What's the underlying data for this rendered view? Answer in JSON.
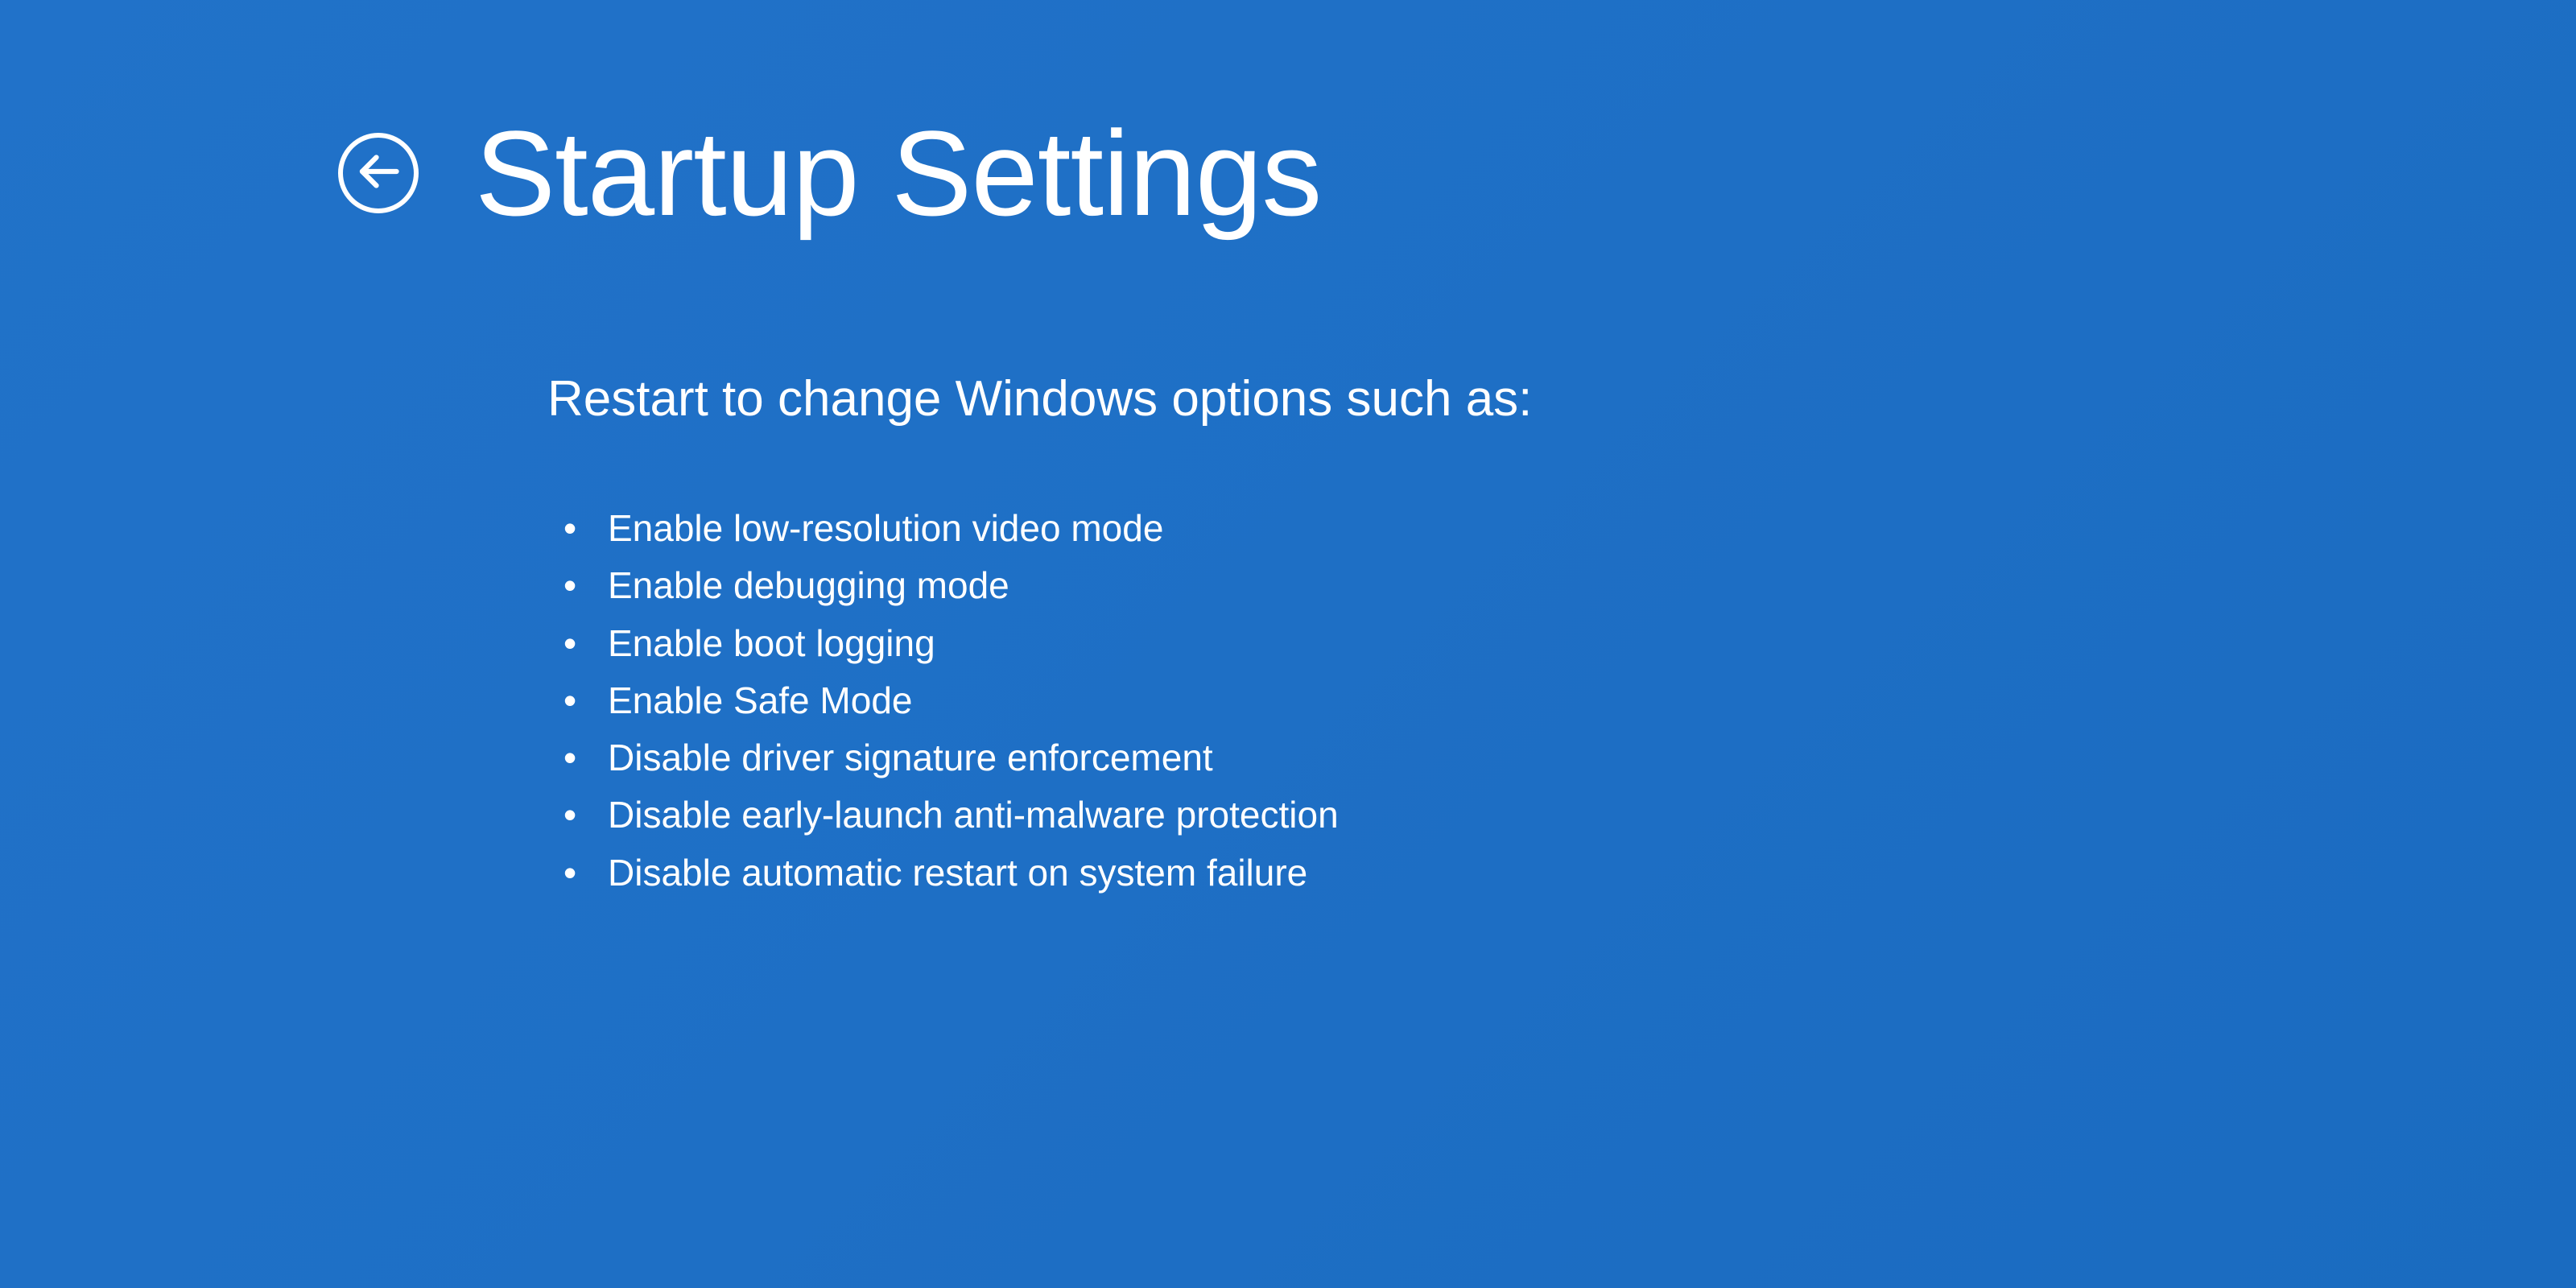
{
  "header": {
    "title": "Startup Settings"
  },
  "content": {
    "subtitle": "Restart to change Windows options such as:",
    "options": [
      "Enable low-resolution video mode",
      "Enable debugging mode",
      "Enable boot logging",
      "Enable Safe Mode",
      "Disable driver signature enforcement",
      "Disable early-launch anti-malware protection",
      "Disable automatic restart on system failure"
    ]
  }
}
